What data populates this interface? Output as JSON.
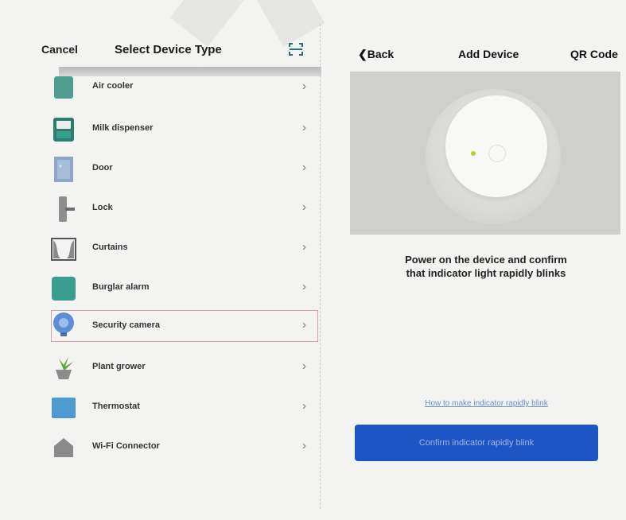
{
  "left": {
    "cancel_label": "Cancel",
    "title": "Select Device Type",
    "items": [
      {
        "label": "Air cooler",
        "icon": "air-cooler-icon"
      },
      {
        "label": "Milk dispenser",
        "icon": "milk-dispenser-icon"
      },
      {
        "label": "Door",
        "icon": "door-icon"
      },
      {
        "label": "Lock",
        "icon": "lock-icon"
      },
      {
        "label": "Curtains",
        "icon": "curtains-icon"
      },
      {
        "label": "Burglar alarm",
        "icon": "burglar-alarm-icon"
      },
      {
        "label": "Security camera",
        "icon": "security-camera-icon",
        "selected": true
      },
      {
        "label": "Plant grower",
        "icon": "plant-grower-icon"
      },
      {
        "label": "Thermostat",
        "icon": "thermostat-icon"
      },
      {
        "label": "Wi-Fi Connector",
        "icon": "wifi-connector-icon"
      }
    ],
    "chevron": "›"
  },
  "right": {
    "back_label": "Back",
    "title": "Add Device",
    "qr_label": "QR Code",
    "instruction_line1": "Power on the device and confirm",
    "instruction_line2": "that indicator light rapidly blinks",
    "help_link": "How to make indicator rapidly blink",
    "confirm_button": "Confirm indicator rapidly blink"
  },
  "colors": {
    "accent": "#1f55c2",
    "teal": "#3a9e8f",
    "link": "#6a90c9"
  }
}
